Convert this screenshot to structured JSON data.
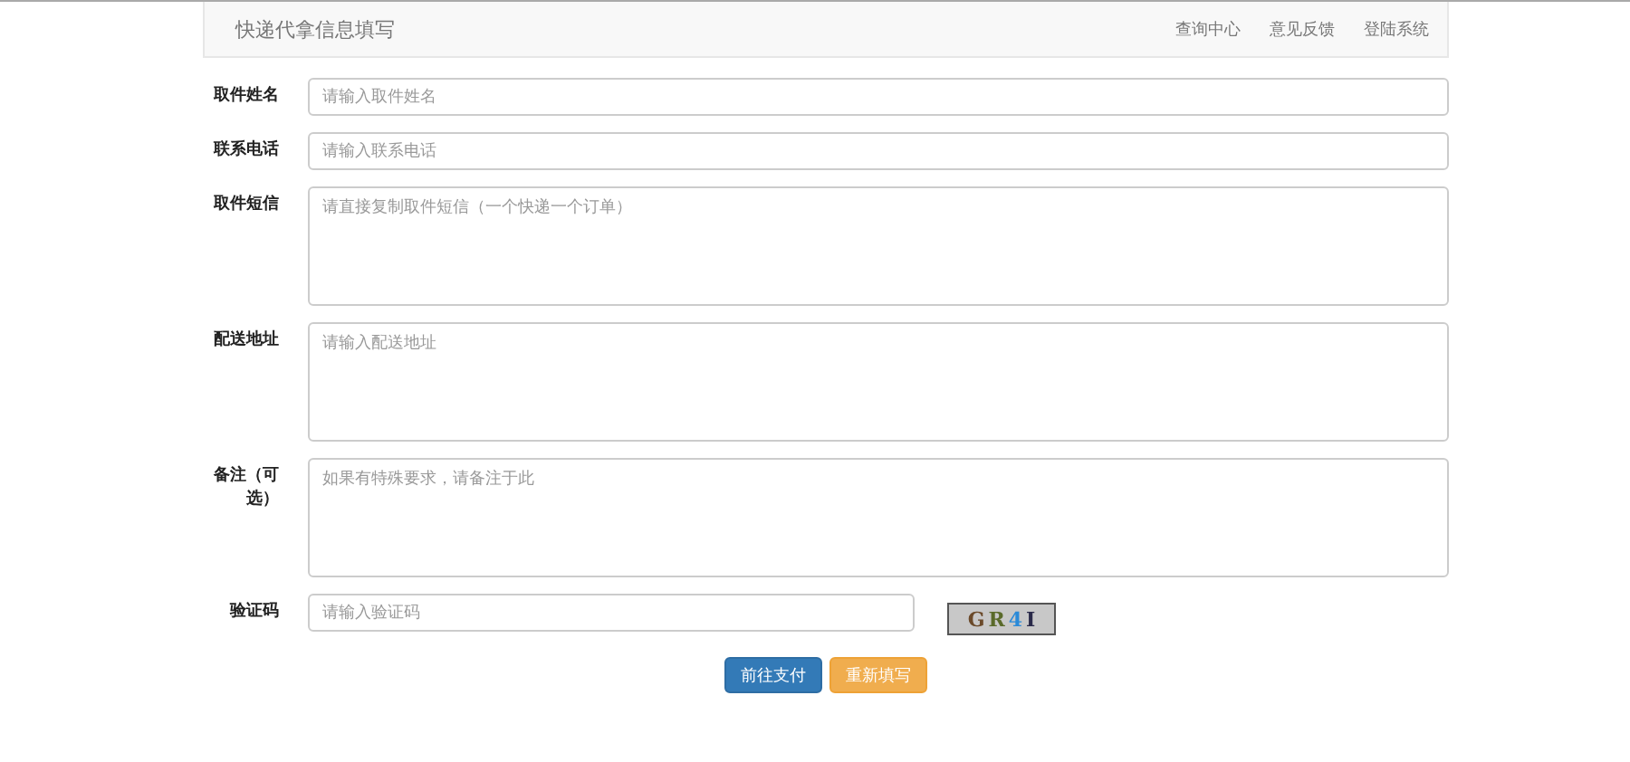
{
  "navbar": {
    "brand": "快递代拿信息填写",
    "links": [
      "查询中心",
      "意见反馈",
      "登陆系统"
    ]
  },
  "fields": [
    {
      "label": "取件姓名",
      "kind": "input",
      "placeholder": "请输入取件姓名"
    },
    {
      "label": "联系电话",
      "kind": "input",
      "placeholder": "请输入联系电话"
    },
    {
      "label": "取件短信",
      "kind": "textarea",
      "placeholder": "请直接复制取件短信（一个快递一个订单）"
    },
    {
      "label": "配送地址",
      "kind": "textarea",
      "placeholder": "请输入配送地址"
    },
    {
      "label": "备注（可选）",
      "kind": "textarea",
      "placeholder": "如果有特殊要求，请备注于此"
    },
    {
      "label": "验证码",
      "kind": "captcha",
      "placeholder": "请输入验证码",
      "captcha": [
        {
          "char": "G",
          "color": "#6b4a2a"
        },
        {
          "char": "R",
          "color": "#5a6a2a"
        },
        {
          "char": "4",
          "color": "#2a8ad8"
        },
        {
          "char": "I",
          "color": "#2a2a4a"
        }
      ]
    }
  ],
  "buttons": [
    {
      "label": "前往支付",
      "kind": "primary"
    },
    {
      "label": "重新填写",
      "kind": "warning"
    }
  ]
}
